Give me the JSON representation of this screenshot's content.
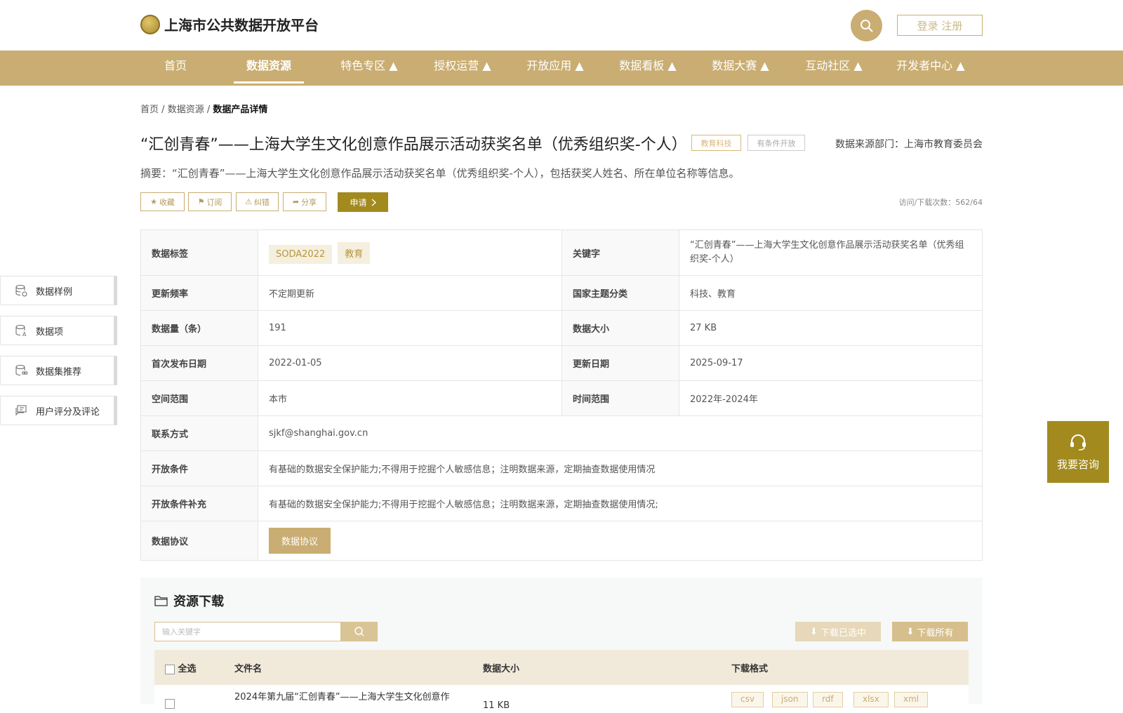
{
  "header": {
    "site_title": "上海市公共数据开放平台",
    "login_label": "登录 注册"
  },
  "nav": [
    "首页",
    "数据资源",
    "特色专区 ▲",
    "授权运营 ▲",
    "开放应用 ▲",
    "数据看板 ▲",
    "数据大赛 ▲",
    "互动社区 ▲",
    "开发者中心 ▲"
  ],
  "breadcrumb": {
    "home": "首页",
    "sep": "/",
    "resources": "数据资源",
    "current": "数据产品详情"
  },
  "dataset": {
    "title": "“汇创青春”——上海大学生文化创意作品展示活动获奖名单（优秀组织奖-个人）",
    "tag_category": "教育科技",
    "tag_open": "有条件开放",
    "source": "数据来源部门：上海市教育委员会",
    "summary": "摘要：“汇创青春”——上海大学生文化创意作品展示活动获奖名单（优秀组织奖-个人），包括获奖人姓名、所在单位名称等信息。",
    "visits": "访问/下载次数：562/64"
  },
  "actions": {
    "favorite": "收藏",
    "subscribe": "订阅",
    "correct": "纠错",
    "share": "分享",
    "apply": "申请"
  },
  "table": {
    "k_tags": "数据标签",
    "tags": [
      "SODA2022",
      "教育"
    ],
    "k_keyword": "关键字",
    "keyword": "“汇创青春”——上海大学生文化创意作品展示活动获奖名单（优秀组织奖-个人）",
    "k_freq": "更新频率",
    "freq": "不定期更新",
    "k_theme": "国家主题分类",
    "theme": "科技、教育",
    "k_count": "数据量（条）",
    "count": "191",
    "k_size": "数据大小",
    "size": "27 KB",
    "k_first": "首次发布日期",
    "first": "2022-01-05",
    "k_updated": "更新日期",
    "updated": "2025-09-17",
    "k_space": "空间范围",
    "space": "本市",
    "k_time": "时间范围",
    "time": "2022年-2024年",
    "k_contact": "联系方式",
    "contact": "sjkf@shanghai.gov.cn",
    "k_cond": "开放条件",
    "cond": "有基础的数据安全保护能力;不得用于挖掘个人敏感信息；注明数据来源，定期抽查数据使用情况",
    "k_cond2": "开放条件补充",
    "cond2": "有基础的数据安全保护能力;不得用于挖掘个人敏感信息；注明数据来源，定期抽查数据使用情况;",
    "k_proto": "数据协议",
    "proto_btn": "数据协议"
  },
  "sidebar": [
    "数据样例",
    "数据项",
    "数据集推荐",
    "用户评分及评论"
  ],
  "consult": "我要咨询",
  "resources": {
    "title": "资源下载",
    "kw_placeholder": "输入关键字",
    "dl_selected": "下载已选中",
    "dl_all": "下载所有",
    "cols": {
      "all": "全选",
      "name": "文件名",
      "size": "数据大小",
      "format": "下载格式"
    },
    "row": {
      "name": "2024年第九届“汇创青春”——上海大学生文化创意作",
      "size": "11 KB",
      "formats": [
        "csv",
        "json",
        "rdf",
        "xlsx",
        "xml"
      ]
    }
  },
  "colors": {
    "gold": "#c9ad72",
    "dark_gold": "#a28a1f"
  }
}
